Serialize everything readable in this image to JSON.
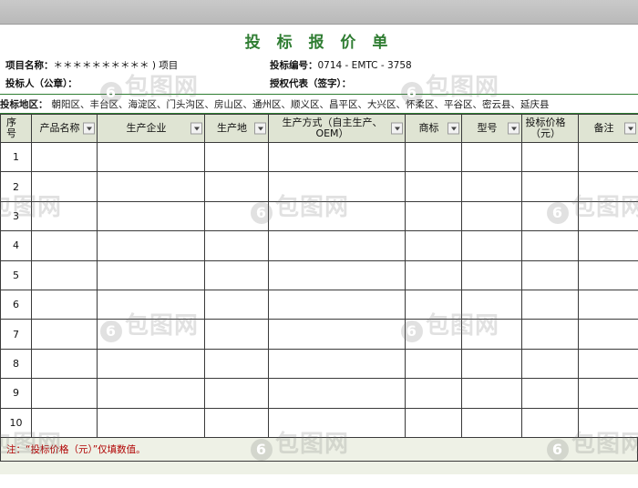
{
  "document": {
    "title": "投 标 报 价 单",
    "title_color": "#2f7d32",
    "info": {
      "project_label": "项目名称：",
      "project_value": "＊＊＊＊＊＊＊＊＊＊ ) 项目",
      "bid_no_label": "投标编号：",
      "bid_no_value": "0714 - EMTC - 3758",
      "bidder_label": "投标人（公章）：",
      "agent_label": "授权代表（签字）：",
      "area_label": "投标地区：",
      "area_value": "朝阳区、丰台区、海淀区、门头沟区、房山区、通州区、顺义区、昌平区、大兴区、怀柔区、平谷区、密云县、延庆县"
    },
    "table": {
      "columns": [
        {
          "label": "序号",
          "filter": false,
          "width": 34
        },
        {
          "label": "产品名称",
          "filter": true,
          "width": 72
        },
        {
          "label": "生产企业",
          "filter": true,
          "width": 118
        },
        {
          "label": "生产地",
          "filter": true,
          "width": 70
        },
        {
          "label": "生产方式（自主生产、OEM）",
          "filter": true,
          "width": 150
        },
        {
          "label": "商标",
          "filter": true,
          "width": 62
        },
        {
          "label": "型号",
          "filter": true,
          "width": 66
        },
        {
          "label": "投标价格（元）",
          "filter": false,
          "width": 62
        },
        {
          "label": "备注",
          "filter": true,
          "width": 66
        }
      ],
      "price_header_line1": "投标价格",
      "price_header_line2": "（元）",
      "rows": [
        {
          "no": "1"
        },
        {
          "no": "2"
        },
        {
          "no": "3"
        },
        {
          "no": "4"
        },
        {
          "no": "5"
        },
        {
          "no": "6"
        },
        {
          "no": "7"
        },
        {
          "no": "8"
        },
        {
          "no": "9"
        },
        {
          "no": "10"
        }
      ]
    },
    "note": "注：“投标价格（元）”仅填数值。"
  },
  "watermarks": {
    "text": "包图网",
    "mark": "6"
  }
}
